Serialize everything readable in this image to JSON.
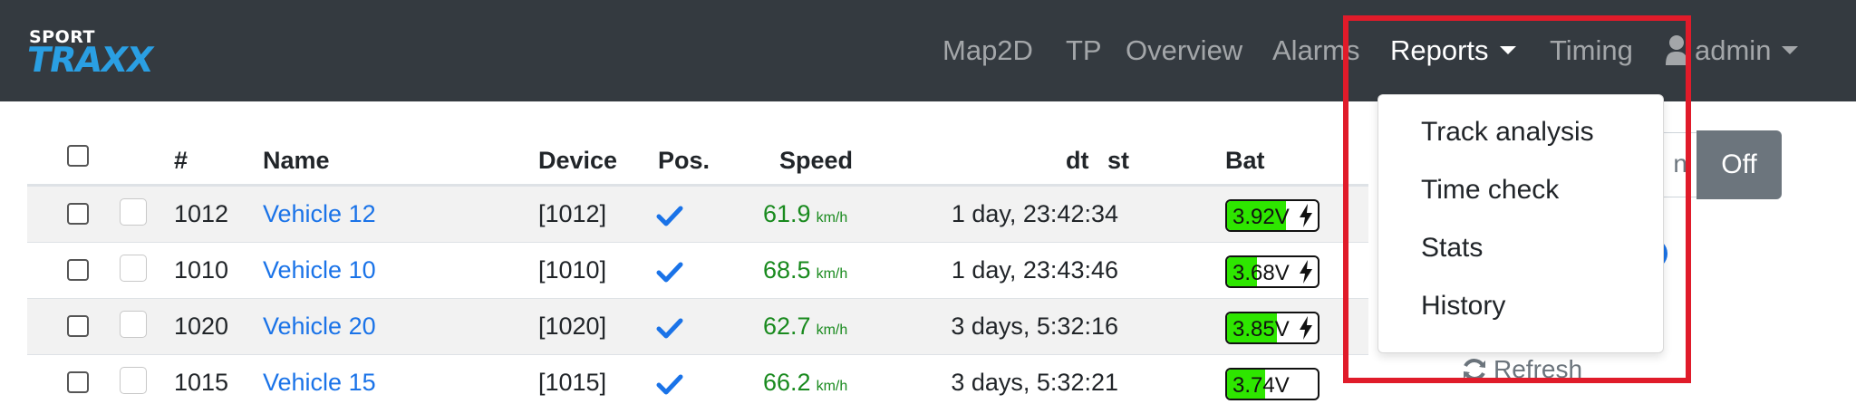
{
  "brand": {
    "small": "SPORT",
    "big": "TRAXX"
  },
  "nav": {
    "map2d": "Map2D",
    "tp": "TP",
    "overview": "Overview",
    "alarms": "Alarms",
    "reports": "Reports",
    "timing": "Timing",
    "user": "admin"
  },
  "table": {
    "headers": {
      "num": "#",
      "name": "Name",
      "device": "Device",
      "pos": "Pos.",
      "speed": "Speed",
      "dt": "dt",
      "st": "st",
      "bat": "Bat"
    },
    "rows": [
      {
        "num": "1012",
        "name": "Vehicle 12",
        "device": "[1012]",
        "speed": "61.9",
        "unit": "km/h",
        "dt": "1 day, 23:42:34",
        "bat": "3.92V",
        "bat_level": 0.65,
        "charging": true
      },
      {
        "num": "1010",
        "name": "Vehicle 10",
        "device": "[1010]",
        "speed": "68.5",
        "unit": "km/h",
        "dt": "1 day, 23:43:46",
        "bat": "3.68V",
        "bat_level": 0.33,
        "charging": true
      },
      {
        "num": "1020",
        "name": "Vehicle 20",
        "device": "[1020]",
        "speed": "62.7",
        "unit": "km/h",
        "dt": "3 days, 5:32:16",
        "bat": "3.85V",
        "bat_level": 0.55,
        "charging": true
      },
      {
        "num": "1015",
        "name": "Vehicle 15",
        "device": "[1015]",
        "speed": "66.2",
        "unit": "km/h",
        "dt": "3 days, 5:32:21",
        "bat": "3.74V",
        "bat_level": 0.42,
        "charging": false
      }
    ]
  },
  "controls": {
    "input_fragment": "n",
    "off": "Off",
    "refresh": "Refresh"
  },
  "reports_menu": {
    "items": [
      "Track analysis",
      "Time check",
      "Stats",
      "History"
    ]
  },
  "colors": {
    "navbar": "#343a40",
    "highlight": "#e01b2a",
    "battery": "#2ee600",
    "speed": "#198a1e",
    "link": "#1a73e8"
  }
}
